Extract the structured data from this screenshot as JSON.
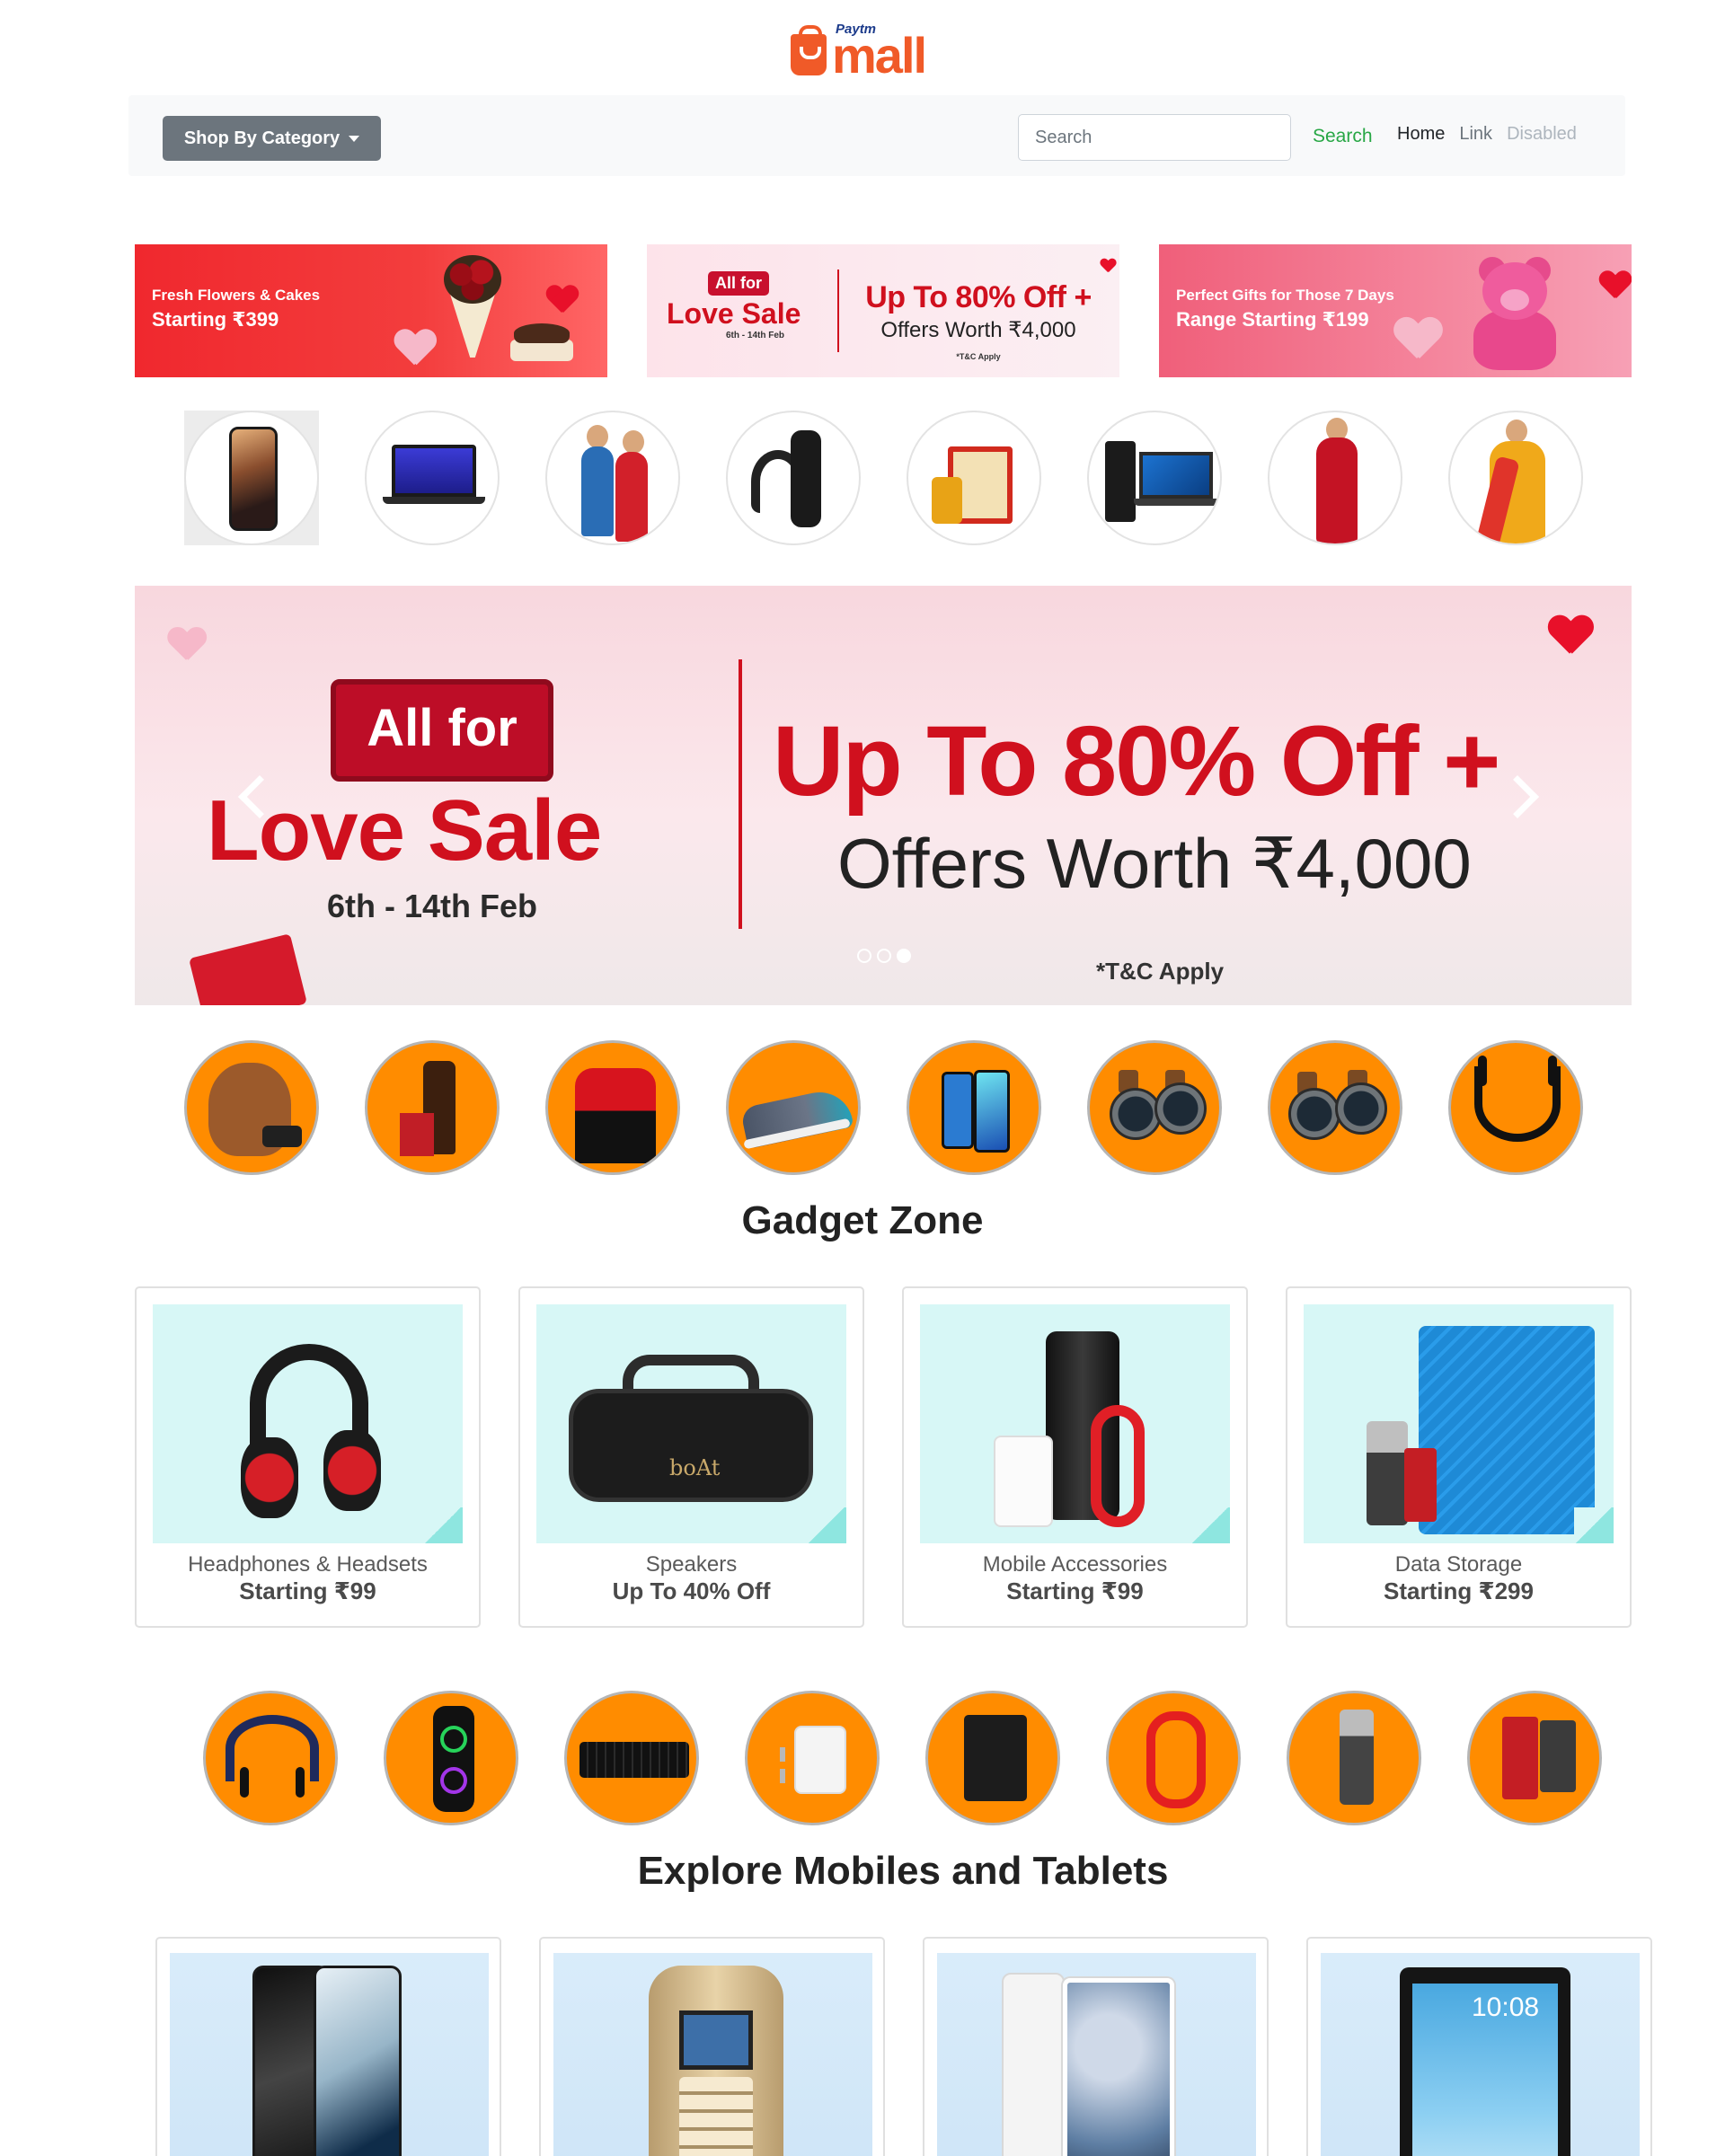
{
  "logo": {
    "brand_small": "Paytm",
    "brand_main": "mall"
  },
  "navbar": {
    "category_button": "Shop By Category",
    "search_placeholder": "Search",
    "search_button": "Search",
    "links": {
      "home": "Home",
      "link": "Link",
      "disabled": "Disabled"
    }
  },
  "promos": [
    {
      "line1": "Fresh Flowers & Cakes",
      "line2": "Starting ₹399"
    },
    {
      "badge": "All for",
      "title": "Love Sale",
      "date": "6th - 14th Feb",
      "offer": "Up To 80% Off +",
      "worth": "Offers Worth ₹4,000",
      "tc": "*T&C Apply"
    },
    {
      "line1": "Perfect Gifts for Those 7 Days",
      "line2": "Range Starting ₹199"
    }
  ],
  "category_icons": [
    "iphone-icon",
    "laptop-icon",
    "couple-fashion-icon",
    "speaker-headphone-icon",
    "grocery-icon",
    "desktop-icon",
    "mens-kurta-icon",
    "womens-kurta-icon"
  ],
  "hero": {
    "badge": "All for",
    "title": "Love Sale",
    "date": "6th - 14th Feb",
    "offer": "Up To 80% Off +",
    "worth": "Offers Worth ₹4,000",
    "tc": "*T&C Apply",
    "active_slide": 3,
    "slide_count": 3
  },
  "deal_icons_1": [
    "teddy-bear-icon",
    "skincare-icon",
    "polo-tshirt-icon",
    "sports-shoe-icon",
    "smartphone-icon",
    "smartwatch-icon",
    "smartwatch-icon",
    "neckband-icon"
  ],
  "gadget_zone": {
    "title": "Gadget Zone",
    "cards": [
      {
        "name": "Headphones & Headsets",
        "offer": "Starting ₹99"
      },
      {
        "name": "Speakers",
        "offer": "Up To 40% Off"
      },
      {
        "name": "Mobile Accessories",
        "offer": "Starting ₹99"
      },
      {
        "name": "Data Storage",
        "offer": "Starting ₹299"
      }
    ]
  },
  "deal_icons_2": [
    "neckband-icon",
    "party-speaker-icon",
    "keyboard-icon",
    "charger-icon",
    "hard-disk-icon",
    "usb-cable-icon",
    "pen-drive-icon",
    "sd-card-icon"
  ],
  "mobiles": {
    "title": "Explore Mobiles and Tablets",
    "cards": [
      "smartphone-image",
      "feature-phone-image",
      "tablet-image",
      "tablet-image"
    ]
  },
  "colors": {
    "brand_orange": "#f05a28",
    "accent_red": "#d0101e",
    "circle_orange": "#ff8c00",
    "search_green": "#28a745"
  }
}
